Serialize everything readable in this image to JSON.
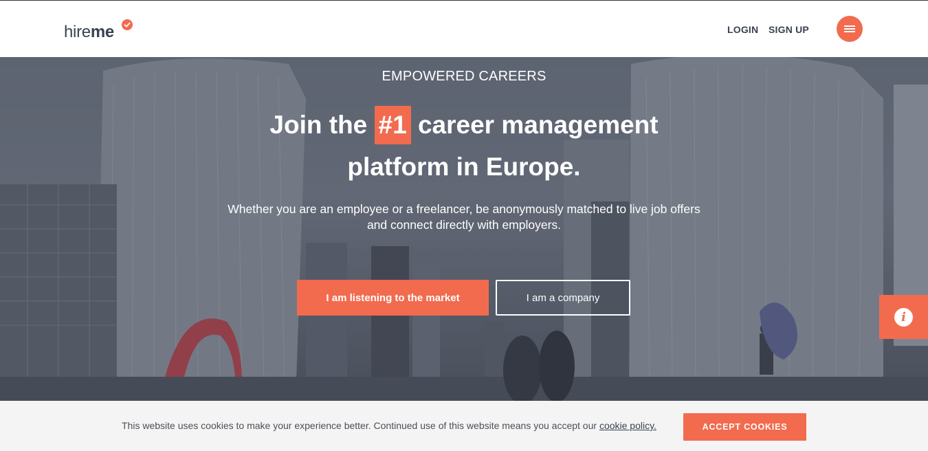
{
  "header": {
    "logo_hire": "hire",
    "logo_me": "me",
    "login": "LOGIN",
    "signup": "SIGN UP",
    "menu_icon": "hamburger-icon"
  },
  "hero": {
    "eyebrow": "EMPOWERED CAREERS",
    "headline_pre": "Join the ",
    "headline_badge": "#1",
    "headline_post": " career management",
    "headline_line2": "platform in Europe.",
    "subtext": "Whether you are an employee or a freelancer, be anonymously matched to live job offers and connect directly with employers.",
    "primary_cta": "I am listening to the market",
    "secondary_cta": "I am a company",
    "info_icon": "info-icon"
  },
  "cookie_bar": {
    "text": "This website uses cookies to make your experience better. Continued use of this website means you accept our ",
    "link": "cookie policy.",
    "accept": "ACCEPT COOKIES"
  },
  "colors": {
    "accent": "#f26b4f",
    "text_dark": "#3a4150",
    "cookie_bg": "#f4f4f4"
  }
}
